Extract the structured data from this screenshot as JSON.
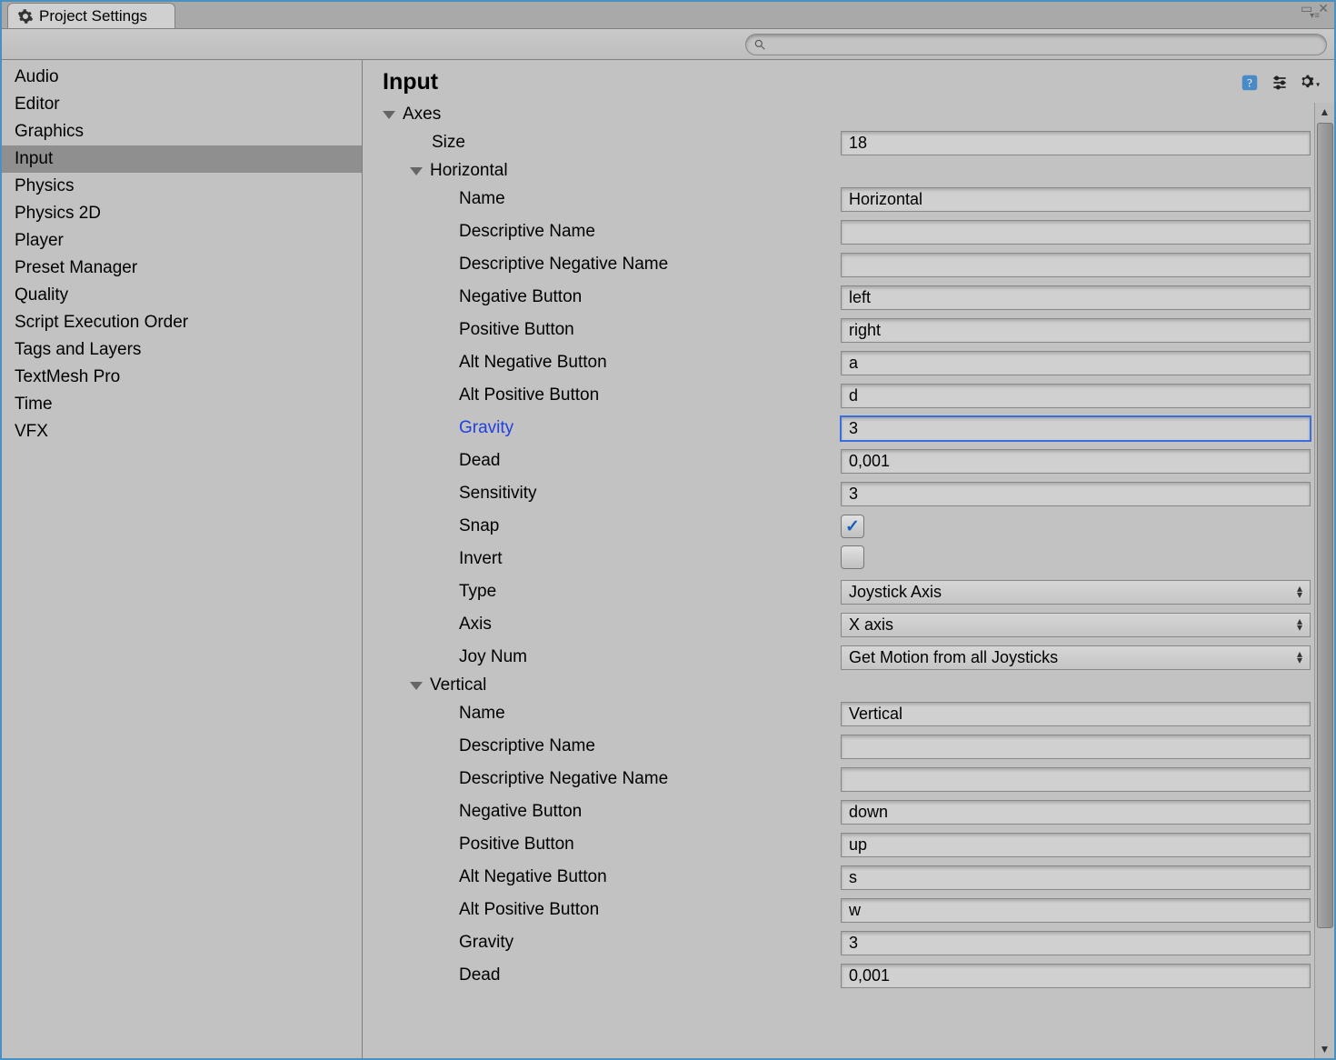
{
  "window": {
    "title": "Project Settings"
  },
  "search": {
    "placeholder": ""
  },
  "sidebar": {
    "items": [
      {
        "label": "Audio"
      },
      {
        "label": "Editor"
      },
      {
        "label": "Graphics"
      },
      {
        "label": "Input",
        "selected": true
      },
      {
        "label": "Physics"
      },
      {
        "label": "Physics 2D"
      },
      {
        "label": "Player"
      },
      {
        "label": "Preset Manager"
      },
      {
        "label": "Quality"
      },
      {
        "label": "Script Execution Order"
      },
      {
        "label": "Tags and Layers"
      },
      {
        "label": "TextMesh Pro"
      },
      {
        "label": "Time"
      },
      {
        "label": "VFX"
      }
    ]
  },
  "panel": {
    "title": "Input",
    "axes_label": "Axes",
    "size_label": "Size",
    "size_value": "18",
    "labels": {
      "name": "Name",
      "descriptive_name": "Descriptive Name",
      "descriptive_negative_name": "Descriptive Negative Name",
      "negative_button": "Negative Button",
      "positive_button": "Positive Button",
      "alt_negative_button": "Alt Negative Button",
      "alt_positive_button": "Alt Positive Button",
      "gravity": "Gravity",
      "dead": "Dead",
      "sensitivity": "Sensitivity",
      "snap": "Snap",
      "invert": "Invert",
      "type": "Type",
      "axis": "Axis",
      "joy_num": "Joy Num"
    },
    "entries": [
      {
        "foldout": "Horizontal",
        "name": "Horizontal",
        "descriptive_name": "",
        "descriptive_negative_name": "",
        "negative_button": "left",
        "positive_button": "right",
        "alt_negative_button": "a",
        "alt_positive_button": "d",
        "gravity": "3",
        "gravity_highlight": true,
        "dead": "0,001",
        "sensitivity": "3",
        "snap": true,
        "invert": false,
        "type": "Joystick Axis",
        "axis": "X axis",
        "joy_num": "Get Motion from all Joysticks"
      },
      {
        "foldout": "Vertical",
        "name": "Vertical",
        "descriptive_name": "",
        "descriptive_negative_name": "",
        "negative_button": "down",
        "positive_button": "up",
        "alt_negative_button": "s",
        "alt_positive_button": "w",
        "gravity": "3",
        "dead": "0,001"
      }
    ]
  }
}
